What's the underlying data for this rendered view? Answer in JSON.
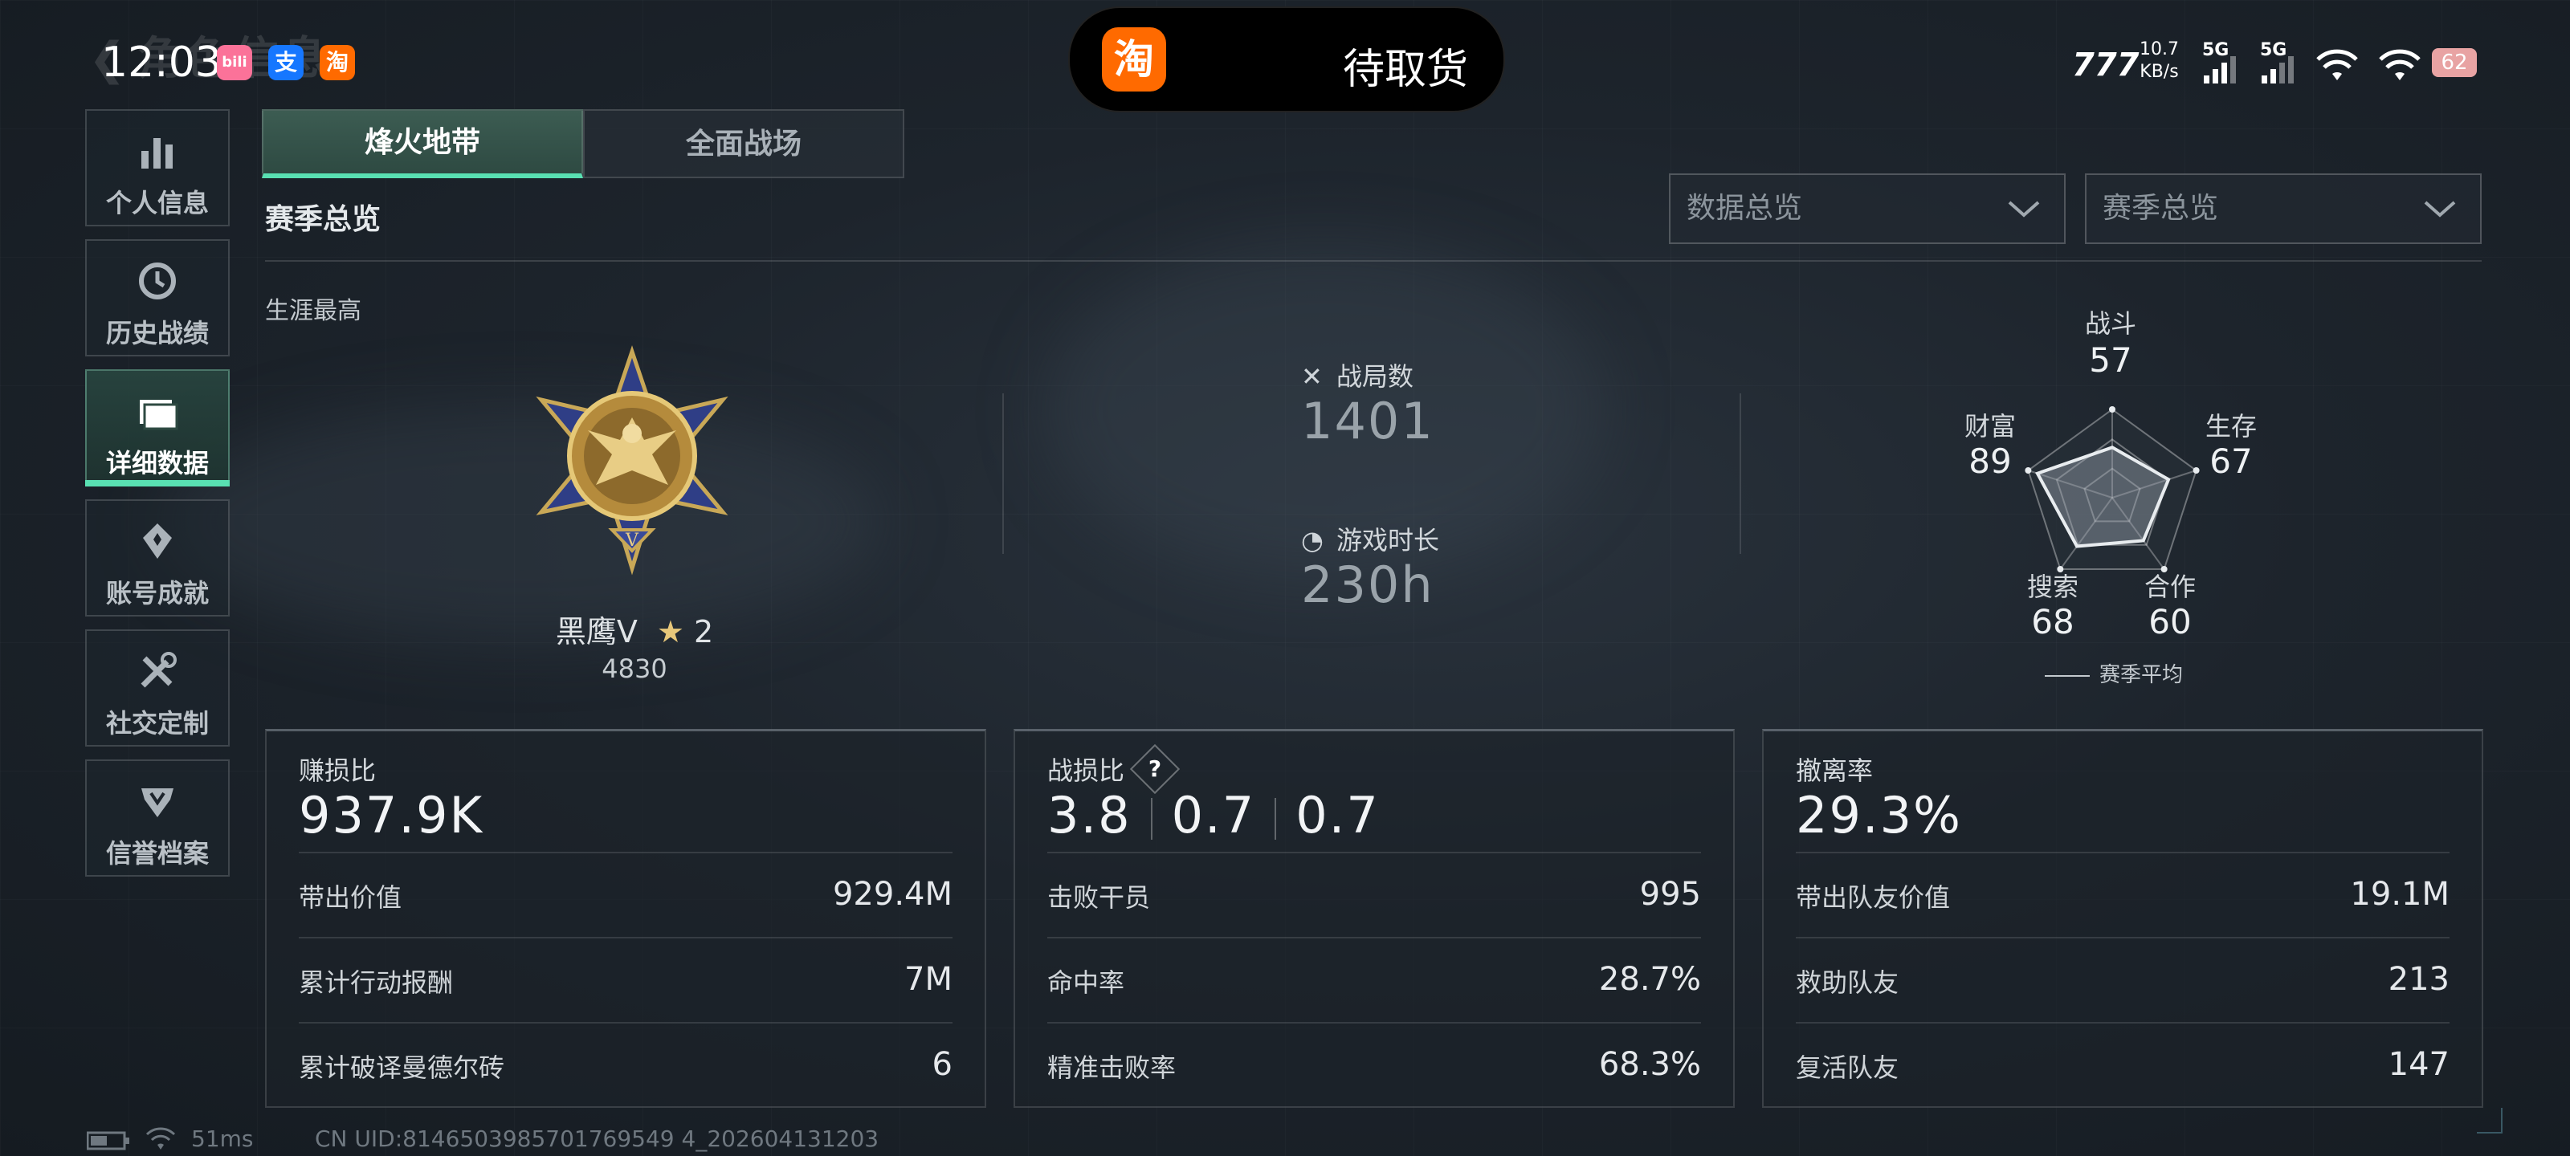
{
  "status": {
    "time": "12:03",
    "ghost_title": "角色信息",
    "apps": [
      {
        "name": "bilibili",
        "glyph": "bili",
        "color": "#fb7299"
      },
      {
        "name": "alipay",
        "glyph": "支",
        "color": "#1677ff"
      },
      {
        "name": "taobao",
        "glyph": "淘",
        "color": "#ff6a00"
      }
    ],
    "island": {
      "icon_glyph": "淘",
      "text": "待取货"
    },
    "net_speed_value": "10.7",
    "net_speed_unit": "KB/s",
    "signal1": "5G",
    "signal2": "5G",
    "battery": "62"
  },
  "sidebar": {
    "items": [
      {
        "label": "个人信息",
        "icon": "bar-chart-icon",
        "glyph": "▮"
      },
      {
        "label": "历史战绩",
        "icon": "clock-icon",
        "glyph": "◷"
      },
      {
        "label": "详细数据",
        "icon": "folder-icon",
        "glyph": "▤"
      },
      {
        "label": "账号成就",
        "icon": "medal-icon",
        "glyph": "✦"
      },
      {
        "label": "社交定制",
        "icon": "tools-icon",
        "glyph": "✂"
      },
      {
        "label": "信誉档案",
        "icon": "badge-icon",
        "glyph": "⛉"
      }
    ]
  },
  "tabs": [
    "烽火地带",
    "全面战场"
  ],
  "section_title": "赛季总览",
  "dropdowns": {
    "left": "数据总览",
    "right": "赛季总览"
  },
  "career": {
    "label": "生涯最高",
    "rank_name": "黑鹰Ⅴ",
    "stars": "2",
    "score": "4830"
  },
  "stats": {
    "matches_label": "战局数",
    "matches_value": "1401",
    "playtime_label": "游戏时长",
    "playtime_value": "230h"
  },
  "radar": {
    "axes": [
      {
        "label": "战斗",
        "value": 57
      },
      {
        "label": "生存",
        "value": 67
      },
      {
        "label": "合作",
        "value": 60
      },
      {
        "label": "搜索",
        "value": 68
      },
      {
        "label": "财富",
        "value": 89
      }
    ],
    "legend": "赛季平均"
  },
  "panels": [
    {
      "title": "赚损比",
      "value": "937.9K",
      "rows": [
        {
          "k": "带出价值",
          "v": "929.4M"
        },
        {
          "k": "累计行动报酬",
          "v": "7M"
        },
        {
          "k": "累计破译曼德尔砖",
          "v": "6"
        }
      ]
    },
    {
      "title": "战损比",
      "help": "?",
      "values": [
        "3.8",
        "0.7",
        "0.7"
      ],
      "rows": [
        {
          "k": "击败干员",
          "v": "995"
        },
        {
          "k": "命中率",
          "v": "28.7%"
        },
        {
          "k": "精准击败率",
          "v": "68.3%"
        }
      ]
    },
    {
      "title": "撤离率",
      "value": "29.3%",
      "rows": [
        {
          "k": "带出队友价值",
          "v": "19.1M"
        },
        {
          "k": "救助队友",
          "v": "213"
        },
        {
          "k": "复活队友",
          "v": "147"
        }
      ]
    }
  ],
  "footer": {
    "ping": "51ms",
    "uid": "CN UID:8146503985701769549 4_202604131203"
  }
}
